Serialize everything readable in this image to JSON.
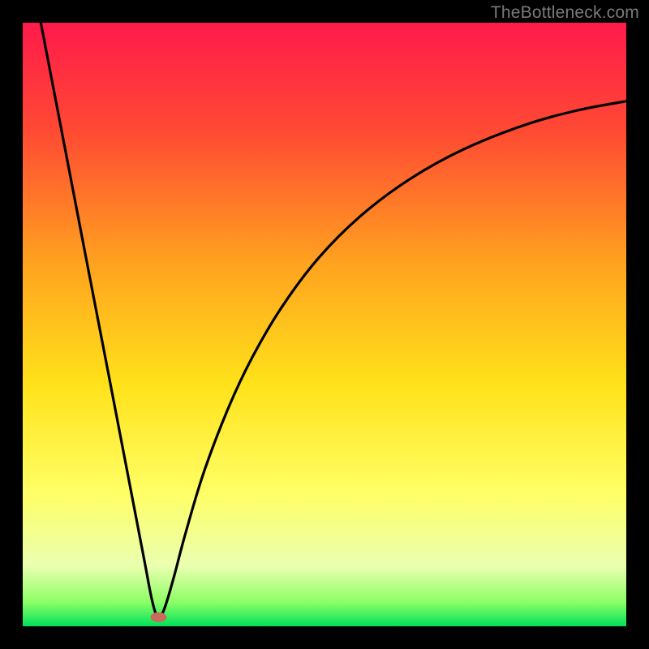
{
  "watermark": "TheBottleneck.com",
  "chart_data": {
    "type": "line",
    "title": "",
    "xlabel": "",
    "ylabel": "",
    "xlim": [
      0,
      100
    ],
    "ylim": [
      0,
      100
    ],
    "gradient_stops": [
      {
        "pct": 0,
        "color": "#ff1a4b"
      },
      {
        "pct": 18,
        "color": "#ff4a33"
      },
      {
        "pct": 40,
        "color": "#ffa31f"
      },
      {
        "pct": 60,
        "color": "#ffe21a"
      },
      {
        "pct": 78,
        "color": "#ffff66"
      },
      {
        "pct": 90,
        "color": "#eaffb0"
      },
      {
        "pct": 96,
        "color": "#8dff66"
      },
      {
        "pct": 100,
        "color": "#00e05a"
      }
    ],
    "marker": {
      "x": 22.5,
      "y": 1.5,
      "color": "#c96a5a"
    },
    "series": [
      {
        "name": "curve",
        "points": [
          {
            "x": 3.0,
            "y": 100.0
          },
          {
            "x": 5.0,
            "y": 89.6
          },
          {
            "x": 8.0,
            "y": 74.0
          },
          {
            "x": 11.0,
            "y": 58.4
          },
          {
            "x": 14.0,
            "y": 42.9
          },
          {
            "x": 17.0,
            "y": 27.3
          },
          {
            "x": 20.0,
            "y": 11.7
          },
          {
            "x": 21.5,
            "y": 4.0
          },
          {
            "x": 22.5,
            "y": 1.5
          },
          {
            "x": 23.5,
            "y": 3.0
          },
          {
            "x": 25.0,
            "y": 8.0
          },
          {
            "x": 27.0,
            "y": 15.5
          },
          {
            "x": 30.0,
            "y": 25.5
          },
          {
            "x": 34.0,
            "y": 36.0
          },
          {
            "x": 38.0,
            "y": 44.5
          },
          {
            "x": 43.0,
            "y": 53.0
          },
          {
            "x": 49.0,
            "y": 61.0
          },
          {
            "x": 56.0,
            "y": 68.0
          },
          {
            "x": 64.0,
            "y": 74.0
          },
          {
            "x": 73.0,
            "y": 79.0
          },
          {
            "x": 83.0,
            "y": 83.0
          },
          {
            "x": 92.0,
            "y": 85.5
          },
          {
            "x": 100.0,
            "y": 87.0
          }
        ]
      }
    ]
  }
}
